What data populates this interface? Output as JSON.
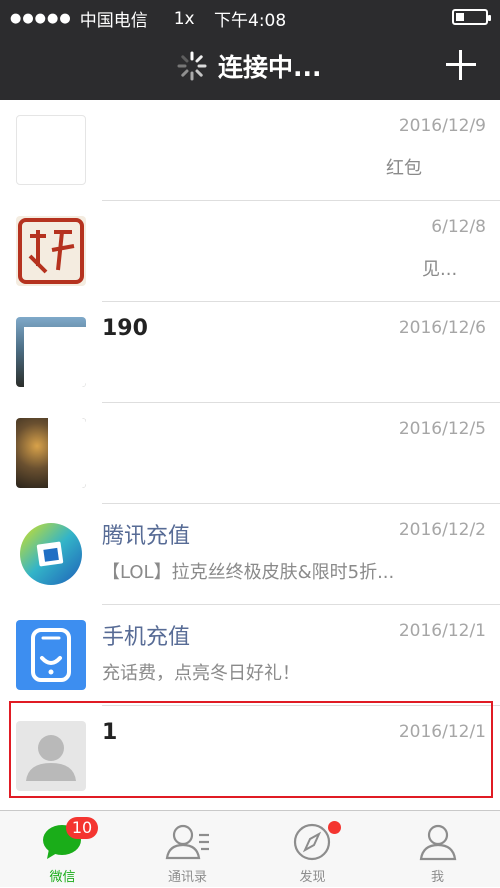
{
  "status_bar": {
    "signal_dots": "●●●●●",
    "carrier": "中国电信",
    "zoom": "1x",
    "time": "下午4:08",
    "battery_icon": "battery-icon"
  },
  "header": {
    "title": "连接中...",
    "spinner_icon": "loading-spinner-icon",
    "plus_icon": "plus-icon"
  },
  "chats": [
    {
      "name": "",
      "preview": "红包",
      "date": "2016/12/9"
    },
    {
      "name": "",
      "preview": "见...",
      "date": "6/12/8"
    },
    {
      "name": "190",
      "preview": "",
      "date": "2016/12/6"
    },
    {
      "name": "",
      "preview": "",
      "date": "2016/12/5"
    },
    {
      "name": "腾讯充值",
      "preview": "【LOL】拉克丝终极皮肤&限时5折...",
      "date": "2016/12/2"
    },
    {
      "name": "手机充值",
      "preview": "充话费，点亮冬日好礼！",
      "date": "2016/12/1"
    },
    {
      "name": "1",
      "preview": "",
      "date": "2016/12/1"
    }
  ],
  "tabs": [
    {
      "label": "微信",
      "icon": "chat-bubble-icon",
      "badge": "10",
      "active": true
    },
    {
      "label": "通讯录",
      "icon": "contacts-icon"
    },
    {
      "label": "发现",
      "icon": "compass-icon",
      "dot": true
    },
    {
      "label": "我",
      "icon": "person-icon"
    }
  ],
  "colors": {
    "nav_bg": "#2c2c2e",
    "active_tab": "#1aad19",
    "badge_red": "#f43530",
    "brand_name": "#576b95",
    "highlight_border": "#e01b24"
  }
}
